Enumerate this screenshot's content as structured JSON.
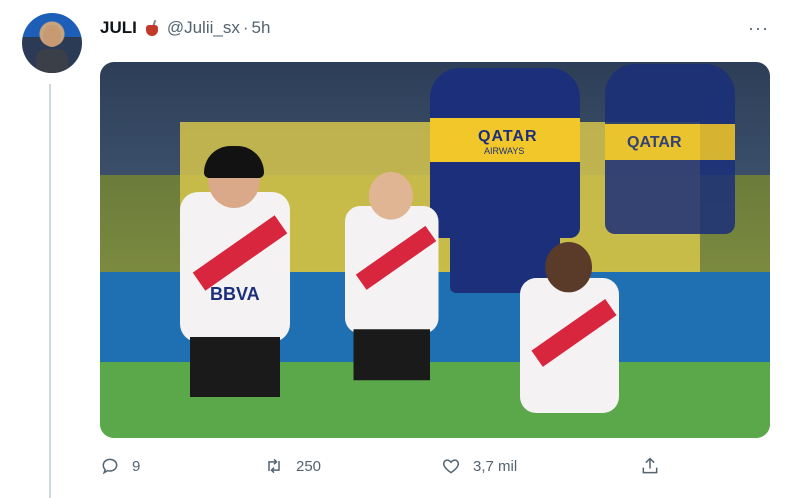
{
  "tweet": {
    "display_name": "JULI",
    "emoji": "mate-cup-icon",
    "handle": "@Julii_sx",
    "separator": "·",
    "time": "5h",
    "more": "···",
    "media": {
      "sponsor_text": "QATAR",
      "sponsor_sub": "AIRWAYS",
      "sponsor_text_2": "QATAR",
      "kid_sponsor": "BBVA"
    },
    "actions": {
      "replies": "9",
      "retweets": "250",
      "likes": "3,7 mil"
    }
  }
}
